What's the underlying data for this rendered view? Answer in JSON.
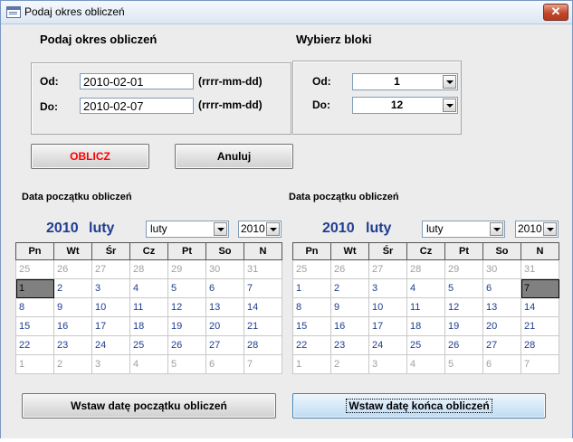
{
  "window": {
    "title": "Podaj okres obliczeń",
    "close_label": "✕"
  },
  "period": {
    "heading": "Podaj okres obliczeń",
    "from_label": "Od:",
    "from_value": "2010-02-01",
    "to_label": "Do:",
    "to_value": "2010-02-07",
    "format_hint": "(rrrr-mm-dd)"
  },
  "blocks": {
    "heading": "Wybierz bloki",
    "from_label": "Od:",
    "from_value": "1",
    "to_label": "Do:",
    "to_value": "12"
  },
  "buttons": {
    "calculate": "OBLICZ",
    "cancel": "Anuluj",
    "insert_start": "Wstaw datę początku obliczeń",
    "insert_end": "Wstaw datę końca obliczeń"
  },
  "colors": {
    "calculate_text": "#ff0000",
    "calendar_text": "#1f3d91"
  },
  "weekdays": [
    "Pn",
    "Wt",
    "Śr",
    "Cz",
    "Pt",
    "So",
    "N"
  ],
  "calendars": [
    {
      "title": "Data początku obliczeń",
      "year": "2010",
      "month": "luty",
      "month_select": "luty",
      "year_select": "2010",
      "selected_day": "1",
      "weeks": [
        [
          "25",
          "26",
          "27",
          "28",
          "29",
          "30",
          "31"
        ],
        [
          "1",
          "2",
          "3",
          "4",
          "5",
          "6",
          "7"
        ],
        [
          "8",
          "9",
          "10",
          "11",
          "12",
          "13",
          "14"
        ],
        [
          "15",
          "16",
          "17",
          "18",
          "19",
          "20",
          "21"
        ],
        [
          "22",
          "23",
          "24",
          "25",
          "26",
          "27",
          "28"
        ],
        [
          "1",
          "2",
          "3",
          "4",
          "5",
          "6",
          "7"
        ]
      ]
    },
    {
      "title": "Data początku obliczeń",
      "year": "2010",
      "month": "luty",
      "month_select": "luty",
      "year_select": "2010",
      "selected_day": "7",
      "weeks": [
        [
          "25",
          "26",
          "27",
          "28",
          "29",
          "30",
          "31"
        ],
        [
          "1",
          "2",
          "3",
          "4",
          "5",
          "6",
          "7"
        ],
        [
          "8",
          "9",
          "10",
          "11",
          "12",
          "13",
          "14"
        ],
        [
          "15",
          "16",
          "17",
          "18",
          "19",
          "20",
          "21"
        ],
        [
          "22",
          "23",
          "24",
          "25",
          "26",
          "27",
          "28"
        ],
        [
          "1",
          "2",
          "3",
          "4",
          "5",
          "6",
          "7"
        ]
      ]
    }
  ]
}
